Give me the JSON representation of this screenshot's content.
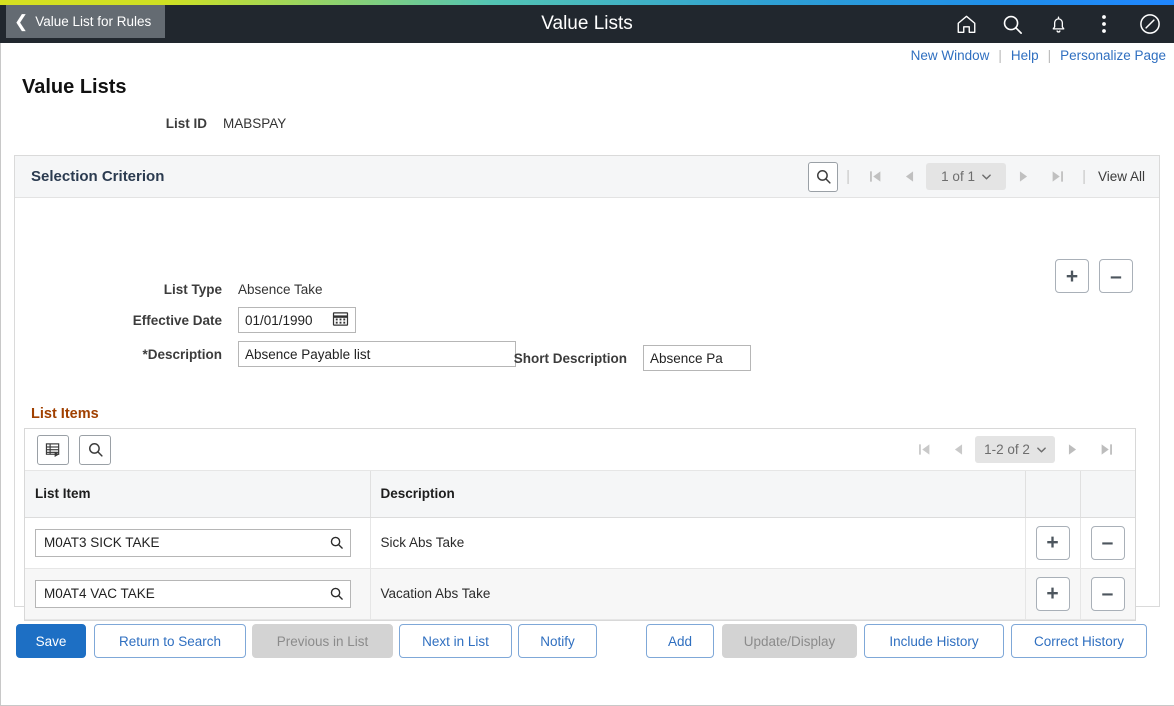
{
  "header": {
    "back_label": "Value List for Rules",
    "title": "Value Lists",
    "icons": [
      {
        "name": "home-icon",
        "label": "Home"
      },
      {
        "name": "search-icon",
        "label": "Search"
      },
      {
        "name": "notification-bell-icon",
        "label": "Notifications"
      },
      {
        "name": "actions-menu-icon",
        "label": "Actions"
      },
      {
        "name": "navbar-compass-icon",
        "label": "NavBar"
      }
    ]
  },
  "toplinks": {
    "new_window": "New Window",
    "help": "Help",
    "personalize_page": "Personalize Page",
    "separator": "|"
  },
  "page": {
    "title": "Value Lists",
    "list_id_label": "List ID",
    "list_id_value": "MABSPAY"
  },
  "selection_criterion": {
    "title": "Selection Criterion",
    "pager": {
      "counter": "1 of 1",
      "view_all": "View All",
      "separator": "|",
      "caret": "⌄"
    },
    "fields": {
      "list_type_label": "List Type",
      "list_type_value": "Absence Take",
      "effective_date_label": "Effective Date",
      "effective_date_value": "01/01/1990",
      "description_label": "*Description",
      "description_value": "Absence Payable list",
      "short_description_label": "Short Description",
      "short_description_value": "Absence Pa"
    },
    "add_row_label": "+",
    "delete_row_label": "–"
  },
  "list_items": {
    "section_label": "List Items",
    "pager": {
      "counter": "1-2 of 2",
      "caret": "⌄"
    },
    "columns": [
      "List Item",
      "Description",
      "",
      ""
    ],
    "rows": [
      {
        "list_item": "M0AT3 SICK TAKE",
        "description": "Sick Abs Take",
        "add": "+",
        "remove": "–"
      },
      {
        "list_item": "M0AT4 VAC TAKE",
        "description": "Vacation Abs Take",
        "add": "+",
        "remove": "–"
      }
    ]
  },
  "buttons": [
    {
      "label": "Save",
      "style": "primary",
      "enabled": true
    },
    {
      "label": "Return to Search",
      "style": "default",
      "enabled": true
    },
    {
      "label": "Previous in List",
      "style": "disabled",
      "enabled": false
    },
    {
      "label": "Next in List",
      "style": "default",
      "enabled": true
    },
    {
      "label": "Notify",
      "style": "default",
      "enabled": true
    },
    {
      "label": "Add",
      "style": "default",
      "enabled": true
    },
    {
      "label": "Update/Display",
      "style": "disabled",
      "enabled": false
    },
    {
      "label": "Include History",
      "style": "default",
      "enabled": true
    },
    {
      "label": "Correct History",
      "style": "default",
      "enabled": true
    }
  ],
  "colors": {
    "header_bg": "#21272e",
    "primary_button": "#1d6fc4",
    "link_blue": "#2f6fc0",
    "section_label": "#a04000"
  }
}
